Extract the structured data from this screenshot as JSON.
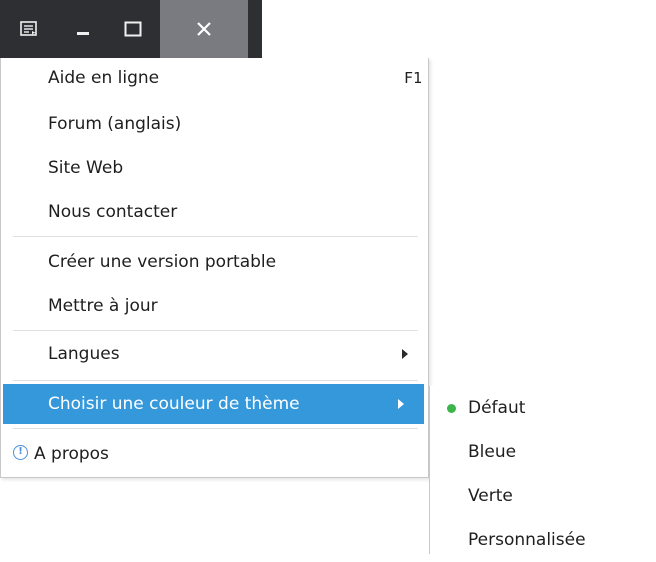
{
  "menu": {
    "items": [
      {
        "label": "Aide en ligne",
        "shortcut": "F1"
      },
      {
        "label": "Forum (anglais)"
      },
      {
        "label": "Site Web"
      },
      {
        "label": "Nous contacter"
      },
      {
        "label": "Créer une version portable"
      },
      {
        "label": "Mettre à jour"
      },
      {
        "label": "Langues"
      },
      {
        "label": "Choisir une couleur de thème"
      },
      {
        "label": "A propos"
      }
    ]
  },
  "submenu": {
    "items": [
      {
        "label": "Défaut",
        "selected": true
      },
      {
        "label": "Bleue"
      },
      {
        "label": "Verte"
      },
      {
        "label": "Personnalisée"
      }
    ]
  },
  "colors": {
    "titlebar": "#2e2f33",
    "highlight": "#3498db",
    "selected_dot": "#3cb54a"
  }
}
